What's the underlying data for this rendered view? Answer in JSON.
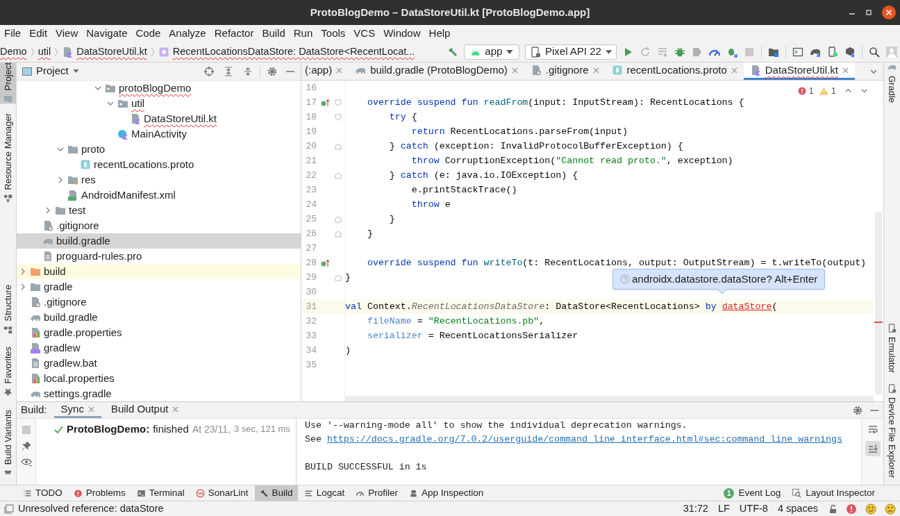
{
  "window": {
    "title": "ProtoBlogDemo – DataStoreUtil.kt [ProtoBlogDemo.app]"
  },
  "menu": [
    "File",
    "Edit",
    "View",
    "Navigate",
    "Code",
    "Analyze",
    "Refactor",
    "Build",
    "Run",
    "Tools",
    "VCS",
    "Window",
    "Help"
  ],
  "breadcrumbs": [
    {
      "label": "Demo",
      "kind": "text",
      "has_error": true
    },
    {
      "label": "util",
      "kind": "text",
      "has_error": true
    },
    {
      "label": "DataStoreUtil.kt",
      "kind": "kotlin-file",
      "has_error": true
    },
    {
      "label": "RecentLocationsDataStore: DataStore<RecentLocat...",
      "kind": "property",
      "has_error": true
    }
  ],
  "run_config": {
    "module": "app",
    "device": "Pixel API 22"
  },
  "left_strip": {
    "top": [
      {
        "label": "Project",
        "kind": "folder",
        "selected": true
      },
      {
        "label": "Resource Manager",
        "kind": "resources",
        "selected": false
      }
    ],
    "bottom": [
      {
        "label": "Structure",
        "kind": "structure",
        "selected": false
      },
      {
        "label": "Favorites",
        "kind": "star",
        "selected": false
      },
      {
        "label": "Build Variants",
        "kind": "android",
        "selected": false
      }
    ]
  },
  "right_strip": {
    "top": [
      {
        "label": "Gradle",
        "kind": "gradle",
        "selected": false
      }
    ],
    "bottom": [
      {
        "label": "Emulator",
        "kind": "device",
        "selected": false
      },
      {
        "label": "Device File Explorer",
        "kind": "device",
        "selected": false
      }
    ]
  },
  "project": {
    "title": "Project",
    "tree": [
      {
        "children": [
          {
            "children": [
              {
                "children": [
                  {
                    "children": [
                      {
                        "children": [
                          {
                            "children": [
                              {
                                "label": "protoBlogDemo",
                                "kind": "package",
                                "expanded": true,
                                "selected": false,
                                "has_error": true,
                                "children": [
                                  {
                                    "label": "util",
                                    "kind": "package",
                                    "expanded": true,
                                    "selected": false,
                                    "has_error": true,
                                    "children": [
                                      {
                                        "label": "DataStoreUtil.kt",
                                        "kind": "kotlin-file",
                                        "selected": false,
                                        "has_error": true
                                      }
                                    ]
                                  },
                                  {
                                    "label": "MainActivity",
                                    "kind": "kotlin-class",
                                    "selected": false,
                                    "has_error": false
                                  }
                                ]
                              }
                            ]
                          }
                        ]
                      }
                    ]
                  },
                  {
                    "label": "proto",
                    "kind": "folder",
                    "expanded": true,
                    "selected": false,
                    "has_error": false,
                    "children": [
                      {
                        "label": "recentLocations.proto",
                        "kind": "proto",
                        "selected": false,
                        "has_error": false
                      }
                    ]
                  },
                  {
                    "label": "res",
                    "kind": "res-folder",
                    "expanded": false,
                    "selected": false,
                    "has_error": false
                  },
                  {
                    "label": "AndroidManifest.xml",
                    "kind": "manifest",
                    "selected": false,
                    "has_error": false
                  }
                ]
              },
              {
                "label": "test",
                "kind": "folder",
                "expanded": false,
                "selected": false,
                "has_error": false
              }
            ]
          },
          {
            "label": ".gitignore",
            "kind": "gitignore",
            "selected": false,
            "has_error": false
          },
          {
            "label": "build.gradle",
            "kind": "gradle",
            "selected": true,
            "has_error": false
          },
          {
            "label": "proguard-rules.pro",
            "kind": "text-file",
            "selected": false,
            "has_error": false
          }
        ]
      },
      {
        "label": "build",
        "kind": "excluded-folder",
        "expanded": false,
        "selected": false,
        "has_error": false
      },
      {
        "label": "gradle",
        "kind": "folder",
        "expanded": false,
        "selected": false,
        "has_error": false
      },
      {
        "label": ".gitignore",
        "kind": "gitignore",
        "selected": false,
        "has_error": false
      },
      {
        "label": "build.gradle",
        "kind": "gradle",
        "selected": false,
        "has_error": false
      },
      {
        "label": "gradle.properties",
        "kind": "properties",
        "selected": false,
        "has_error": false
      },
      {
        "label": "gradlew",
        "kind": "script",
        "selected": false,
        "has_error": false
      },
      {
        "label": "gradlew.bat",
        "kind": "text-file",
        "selected": false,
        "has_error": false
      },
      {
        "label": "local.properties",
        "kind": "properties",
        "selected": false,
        "has_error": false
      },
      {
        "label": "settings.gradle",
        "kind": "gradle",
        "selected": false,
        "has_error": false
      }
    ]
  },
  "editor": {
    "tabs": [
      {
        "label": "(:app)",
        "kind": "partial",
        "selected": false,
        "has_error": false
      },
      {
        "label": "build.gradle (ProtoBlogDemo)",
        "kind": "gradle",
        "selected": false,
        "has_error": false
      },
      {
        "label": ".gitignore",
        "kind": "gitignore",
        "selected": false,
        "has_error": false
      },
      {
        "label": "recentLocations.proto",
        "kind": "proto",
        "selected": false,
        "has_error": false
      },
      {
        "label": "DataStoreUtil.kt",
        "kind": "kotlin-file",
        "selected": true,
        "has_error": true
      }
    ],
    "inspections": {
      "errors": "1",
      "warnings": "1"
    },
    "lines": [
      {
        "number": "16",
        "kind": "code",
        "current": false
      },
      {
        "number": "17",
        "kind": "override_fold_start",
        "current": false,
        "tokens": [
          {
            "text": "    override suspend fun ",
            "kind": "keyword"
          },
          {
            "text": "readFrom",
            "kind": "function"
          },
          {
            "text": "(input: InputStream): RecentLocations {",
            "kind": "plain"
          }
        ]
      },
      {
        "number": "18",
        "kind": "fold_start",
        "current": false,
        "tokens": [
          {
            "text": "        try",
            "kind": "keyword"
          },
          {
            "text": " {",
            "kind": "plain"
          }
        ]
      },
      {
        "number": "19",
        "kind": "code",
        "current": false,
        "tokens": [
          {
            "text": "            return",
            "kind": "keyword"
          },
          {
            "text": " RecentLocations.parseFrom(input)",
            "kind": "plain"
          }
        ]
      },
      {
        "number": "20",
        "kind": "fold_end",
        "current": false,
        "tokens": [
          {
            "text": "        } ",
            "kind": "plain"
          },
          {
            "text": "catch",
            "kind": "keyword"
          },
          {
            "text": " (exception: InvalidProtocolBufferException) {",
            "kind": "plain"
          }
        ]
      },
      {
        "number": "21",
        "kind": "code",
        "current": false,
        "tokens": [
          {
            "text": "            throw",
            "kind": "keyword"
          },
          {
            "text": " CorruptionException(",
            "kind": "plain"
          },
          {
            "text": "\"Cannot read proto.\"",
            "kind": "string"
          },
          {
            "text": ", exception)",
            "kind": "plain"
          }
        ]
      },
      {
        "number": "22",
        "kind": "fold_end",
        "current": false,
        "tokens": [
          {
            "text": "        } ",
            "kind": "plain"
          },
          {
            "text": "catch",
            "kind": "keyword"
          },
          {
            "text": " (e: java.io.IOException) {",
            "kind": "plain"
          }
        ]
      },
      {
        "number": "23",
        "kind": "code",
        "current": false,
        "tokens": [
          {
            "text": "            e.printStackTrace()",
            "kind": "plain"
          }
        ]
      },
      {
        "number": "24",
        "kind": "code",
        "current": false,
        "tokens": [
          {
            "text": "            throw",
            "kind": "keyword"
          },
          {
            "text": " e",
            "kind": "plain"
          }
        ]
      },
      {
        "number": "25",
        "kind": "fold_end",
        "current": false,
        "tokens": [
          {
            "text": "        }",
            "kind": "plain"
          }
        ]
      },
      {
        "number": "26",
        "kind": "fold_end",
        "current": false,
        "tokens": [
          {
            "text": "    }",
            "kind": "plain"
          }
        ]
      },
      {
        "number": "27",
        "kind": "code",
        "current": false
      },
      {
        "number": "28",
        "kind": "override",
        "current": false,
        "tokens": [
          {
            "text": "    override suspend fun ",
            "kind": "keyword"
          },
          {
            "text": "writeTo",
            "kind": "function"
          },
          {
            "text": "(t: RecentLocations, output: OutputStream) = t.writeTo(output)",
            "kind": "plain"
          }
        ]
      },
      {
        "number": "29",
        "kind": "fold_end",
        "current": false,
        "tokens": [
          {
            "text": "}",
            "kind": "plain"
          }
        ]
      },
      {
        "number": "30",
        "kind": "code",
        "current": false
      },
      {
        "number": "31",
        "kind": "code",
        "current": true,
        "tokens": [
          {
            "text": "val",
            "kind": "keyword"
          },
          {
            "text": " Context.",
            "kind": "plain"
          },
          {
            "text": "RecentLocationsDataStore",
            "kind": "italic"
          },
          {
            "text": ": DataStore<RecentLocations> ",
            "kind": "plain"
          },
          {
            "text": "by ",
            "kind": "keyword"
          },
          {
            "text": "dataStore",
            "kind": "error"
          },
          {
            "text": "(",
            "kind": "plain"
          }
        ]
      },
      {
        "number": "32",
        "kind": "code",
        "current": false,
        "tokens": [
          {
            "text": "    fileName",
            "kind": "named_arg"
          },
          {
            "text": " = ",
            "kind": "plain"
          },
          {
            "text": "\"RecentLocations.pb\"",
            "kind": "string"
          },
          {
            "text": ",",
            "kind": "plain"
          }
        ]
      },
      {
        "number": "33",
        "kind": "code",
        "current": false,
        "tokens": [
          {
            "text": "    serializer",
            "kind": "named_arg"
          },
          {
            "text": " = RecentLocationsSerializer",
            "kind": "plain"
          }
        ]
      },
      {
        "number": "34",
        "kind": "code",
        "current": false,
        "tokens": [
          {
            "text": ")",
            "kind": "plain"
          }
        ]
      },
      {
        "number": "35",
        "kind": "code",
        "current": false
      }
    ],
    "tooltip": "androidx.datastore.dataStore? Alt+Enter"
  },
  "build": {
    "label": "Build:",
    "tabs": [
      {
        "label": "Sync",
        "selected": true
      },
      {
        "label": "Build Output",
        "selected": false
      }
    ],
    "result": {
      "name": "ProtoBlogDemo:",
      "status": "finished",
      "time": "At 23/11,",
      "duration": "3 sec, 121 ms"
    },
    "console": [
      {
        "kind": "text",
        "text": "Use '--warning-mode all' to show the individual deprecation warnings."
      },
      {
        "kind": "link_line",
        "text": "See ",
        "link": "https://docs.gradle.org/7.0.2/userguide/command_line_interface.html#sec:command_line_warnings"
      },
      {
        "kind": "blank"
      },
      {
        "kind": "text",
        "text": "BUILD SUCCESSFUL in 1s"
      }
    ]
  },
  "tool_windows": {
    "left": [
      {
        "label": "TODO",
        "kind": "list",
        "selected": false
      },
      {
        "label": "Problems",
        "kind": "problems",
        "selected": false
      },
      {
        "label": "Terminal",
        "kind": "terminal",
        "selected": false
      },
      {
        "label": "SonarLint",
        "kind": "sonar",
        "selected": false
      },
      {
        "label": "Build",
        "kind": "hammer",
        "selected": true
      },
      {
        "label": "Logcat",
        "kind": "lines",
        "selected": false
      },
      {
        "label": "Profiler",
        "kind": "gauge",
        "selected": false
      },
      {
        "label": "App Inspection",
        "kind": "inspect",
        "selected": false
      }
    ],
    "right": [
      {
        "label": "Event Log",
        "kind": "notifications",
        "badge": "1"
      },
      {
        "label": "Layout Inspector",
        "kind": "layout"
      }
    ]
  },
  "status_bar": {
    "message": "Unresolved reference: dataStore",
    "position": "31:72",
    "line_separator": "LF",
    "encoding": "UTF-8",
    "indent": "4 spaces"
  }
}
